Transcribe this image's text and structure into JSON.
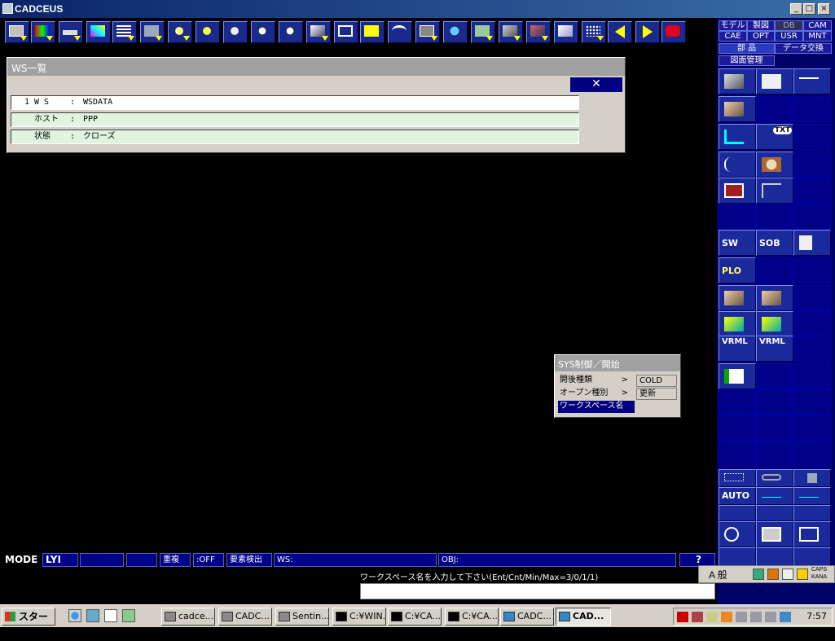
{
  "window": {
    "title": "CADCEUS",
    "min": "_",
    "max": "□",
    "close": "×"
  },
  "right_tabs": [
    {
      "label": "モデル"
    },
    {
      "label": "製図"
    },
    {
      "label": "DB"
    },
    {
      "label": "CAM"
    },
    {
      "label": "CAE"
    },
    {
      "label": "OPT"
    },
    {
      "label": "USR"
    },
    {
      "label": "MNT"
    },
    {
      "label": "部 品"
    },
    {
      "label": "データ交換"
    },
    {
      "label": "図面管理"
    }
  ],
  "right_buttons": {
    "txt": "TXT",
    "sw": "SW",
    "sob": "SOB",
    "plo": "PLO",
    "vrml1": "VRML",
    "vrml2": "VRML",
    "auto": "AUTO"
  },
  "ws_window": {
    "title": "WS一覧",
    "close": "✕",
    "rows": [
      {
        "num": "1",
        "key": "W S",
        "sep": ":",
        "value": "WSDATA"
      },
      {
        "num": "",
        "key": "ホスト",
        "sep": ":",
        "value": "PPP"
      },
      {
        "num": "",
        "key": "状態",
        "sep": ":",
        "value": "クローズ"
      }
    ]
  },
  "sys_menu": {
    "title": "SYS制御／開始",
    "items": [
      {
        "label": "開後種類",
        "arrow": ">"
      },
      {
        "label": "オープン種別",
        "arrow": ">"
      },
      {
        "label": "ワークスペース名",
        "arrow": ""
      }
    ],
    "sub": [
      "COLD",
      "更新"
    ]
  },
  "status": {
    "mode": "MODE",
    "lyi": "LYI",
    "color": "重複",
    "off": ":OFF",
    "detect": "要素検出",
    "ws": "WS:",
    "obj": "OBJ:",
    "help": "?"
  },
  "prompt": "ワークスペース名を入力して下さい(Ent/Cnt/Min/Max=3/0/1/1)",
  "ime": {
    "mode": "A 般",
    "caps": "CAPS",
    "kana": "KANA"
  },
  "taskbar": {
    "start": "スタート",
    "tasks": [
      {
        "label": "cadce..."
      },
      {
        "label": "CADC..."
      },
      {
        "label": "Sentin..."
      },
      {
        "label": "C:¥WIN..."
      },
      {
        "label": "C:¥CA..."
      },
      {
        "label": "C:¥CA..."
      },
      {
        "label": "CADC..."
      },
      {
        "label": "CAD..."
      }
    ],
    "clock": "7:57"
  },
  "colors": {
    "panel": "#000066",
    "button": "#1a2a8a",
    "menu_highlight": "#000080",
    "row_fill": "#dff5df"
  }
}
